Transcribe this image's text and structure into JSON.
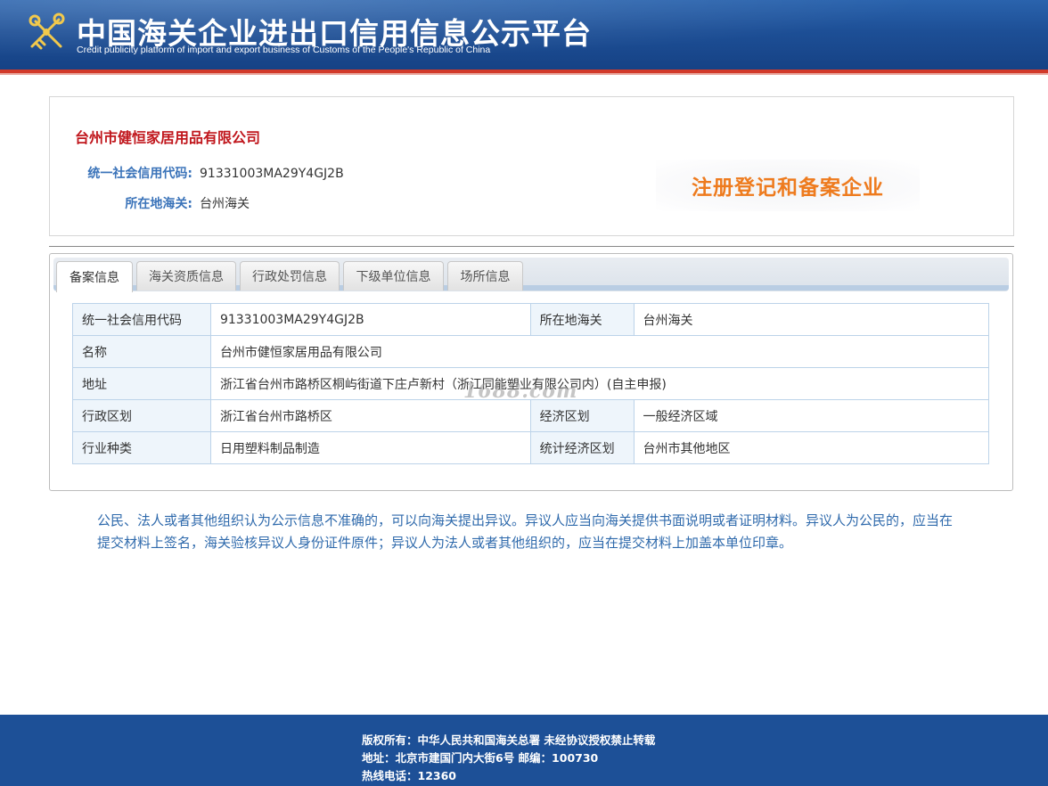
{
  "header": {
    "title": "中国海关企业进出口信用信息公示平台",
    "subtitle": "Credit publicity platform of import and export business of Customs of the People's Republic of China"
  },
  "company": {
    "name": "台州市健恒家居用品有限公司",
    "credit_code_label": "统一社会信用代码:",
    "credit_code": "91331003MA29Y4GJ2B",
    "customs_label": "所在地海关:",
    "customs": "台州海关",
    "badge": "注册登记和备案企业"
  },
  "tabs": [
    {
      "label": "备案信息",
      "active": true
    },
    {
      "label": "海关资质信息",
      "active": false
    },
    {
      "label": "行政处罚信息",
      "active": false
    },
    {
      "label": "下级单位信息",
      "active": false
    },
    {
      "label": "场所信息",
      "active": false
    }
  ],
  "table": {
    "credit_code_label": "统一社会信用代码",
    "credit_code": "91331003MA29Y4GJ2B",
    "customs_label": "所在地海关",
    "customs": "台州海关",
    "name_label": "名称",
    "name": "台州市健恒家居用品有限公司",
    "address_label": "地址",
    "address": "浙江省台州市路桥区桐屿街道下庄卢新村（浙江同能塑业有限公司内）(自主申报)",
    "region_label": "行政区划",
    "region": "浙江省台州市路桥区",
    "economic_zone_label": "经济区划",
    "economic_zone": "一般经济区域",
    "industry_label": "行业种类",
    "industry": "日用塑料制品制造",
    "stat_zone_label": "统计经济区划",
    "stat_zone": "台州市其他地区"
  },
  "watermark": "1688.com",
  "notice": "公民、法人或者其他组织认为公示信息不准确的，可以向海关提出异议。异议人应当向海关提供书面说明或者证明材料。异议人为公民的，应当在提交材料上签名，海关验核异议人身份证件原件；异议人为法人或者其他组织的，应当在提交材料上加盖本单位印章。",
  "footer": {
    "copyright": "版权所有：中华人民共和国海关总署  未经协议授权禁止转载",
    "address": "地址：北京市建国门内大街6号 邮编：100730",
    "hotline": "热线电话：12360"
  },
  "colors": {
    "header_blue": "#1d4f96",
    "accent_red": "#c0161c",
    "label_blue": "#3a73b9",
    "badge_orange": "#ee7b1e",
    "footer_blue": "#1d5097"
  }
}
